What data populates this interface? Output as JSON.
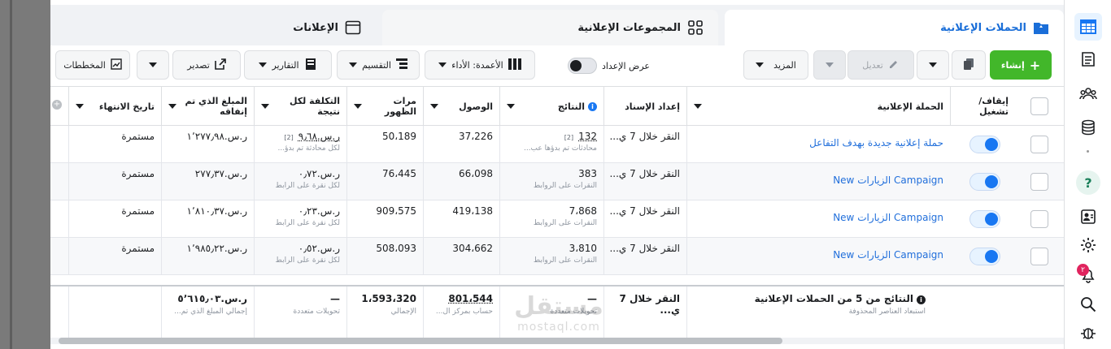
{
  "tabs": [
    {
      "label": "الحملات الإعلانية",
      "icon": "folder-icon",
      "active": true
    },
    {
      "label": "المجموعات الإعلانية",
      "icon": "grid-icon",
      "active": false
    },
    {
      "label": "الإعلانات",
      "icon": "ad-frame-icon",
      "active": false
    }
  ],
  "toolbar": {
    "create_label": "إنشاء",
    "edit_label": "تعديل",
    "more_label": "المزيد",
    "setup_view_label": "عرض الإعداد",
    "columns_label": "الأعمدة: الأداء",
    "breakdown_label": "التقسيم",
    "reports_label": "التقارير",
    "export_label": "تصدير",
    "charts_label": "المخططات"
  },
  "table": {
    "headers": {
      "onoff": "إيقاف/ تشغيل",
      "campaign": "الحملة الإعلانية",
      "attribution": "إعداد الإسناد",
      "results": "النتائج",
      "reach": "الوصول",
      "impressions": "مرات الظهور",
      "cost_per_result": "التكلفة لكل نتيجة",
      "amount_spent": "المبلغ الذي تم إنفاقه",
      "end_date": "تاريخ الانتهاء"
    },
    "rows": [
      {
        "campaign": "حملة إعلانية جديدة بهدف التفاعل",
        "attribution": "النقر خلال 7 ي...",
        "results": "132",
        "results_note": "[2]",
        "results_sub": "محادثات تم بدؤها عب...",
        "reach": "37،226",
        "impressions": "50،189",
        "cpr": "ر.س.‏٩٫٦٨",
        "cpr_note": "[2]",
        "cpr_sub": "لكل محادثة تم بدؤ...",
        "spent": "ر.س.‏١٬٢٧٧٫٩٨",
        "end": "مستمرة"
      },
      {
        "campaign": "Campaign الزيارات New",
        "attribution": "النقر خلال 7 ي...",
        "results": "383",
        "results_note": "",
        "results_sub": "النقرات على الروابط",
        "reach": "66،098",
        "impressions": "76،445",
        "cpr": "ر.س.‏٠٫٧٢",
        "cpr_note": "",
        "cpr_sub": "لكل نقرة على الرابط",
        "spent": "ر.س.‏٢٧٧٫٣٧",
        "end": "مستمرة"
      },
      {
        "campaign": "Campaign الزيارات New",
        "attribution": "النقر خلال 7 ي...",
        "results": "7،868",
        "results_note": "",
        "results_sub": "النقرات على الروابط",
        "reach": "419،138",
        "impressions": "909،575",
        "cpr": "ر.س.‏٠٫٢٣",
        "cpr_note": "",
        "cpr_sub": "لكل نقرة على الرابط",
        "spent": "ر.س.‏١٬٨١٠٫٣٧",
        "end": "مستمرة"
      },
      {
        "campaign": "Campaign الزيارات New",
        "attribution": "النقر خلال 7 ي...",
        "results": "3،810",
        "results_note": "",
        "results_sub": "النقرات على الروابط",
        "reach": "304،662",
        "impressions": "508،093",
        "cpr": "ر.س.‏٠٫٥٢",
        "cpr_note": "",
        "cpr_sub": "لكل نقرة على الرابط",
        "spent": "ر.س.‏١٬٩٨٥٫٢٢",
        "end": "مستمرة"
      }
    ],
    "footer": {
      "title": "النتائج من 5 من الحملات الإعلانية",
      "sub": "استبعاد العناصر المحذوفة",
      "attribution": "النقر خلال 7 ي...",
      "results": "—",
      "results_sub": "تحويلات متعددة",
      "reach": "801،544",
      "reach_sub": "حساب بمركز ال...",
      "impressions": "1،593،320",
      "impressions_sub": "الإجمالي",
      "cpr": "—",
      "cpr_sub": "تحويلات متعددة",
      "spent": "ر.س.‏٥٬٦١٥٫٠٣",
      "spent_sub": "إجمالي المبلغ الذي تم...",
      "end": ""
    }
  },
  "watermark": {
    "line1": "مستقل",
    "line2": "mostaql.com"
  },
  "rail": {
    "notification_count": "٢"
  }
}
